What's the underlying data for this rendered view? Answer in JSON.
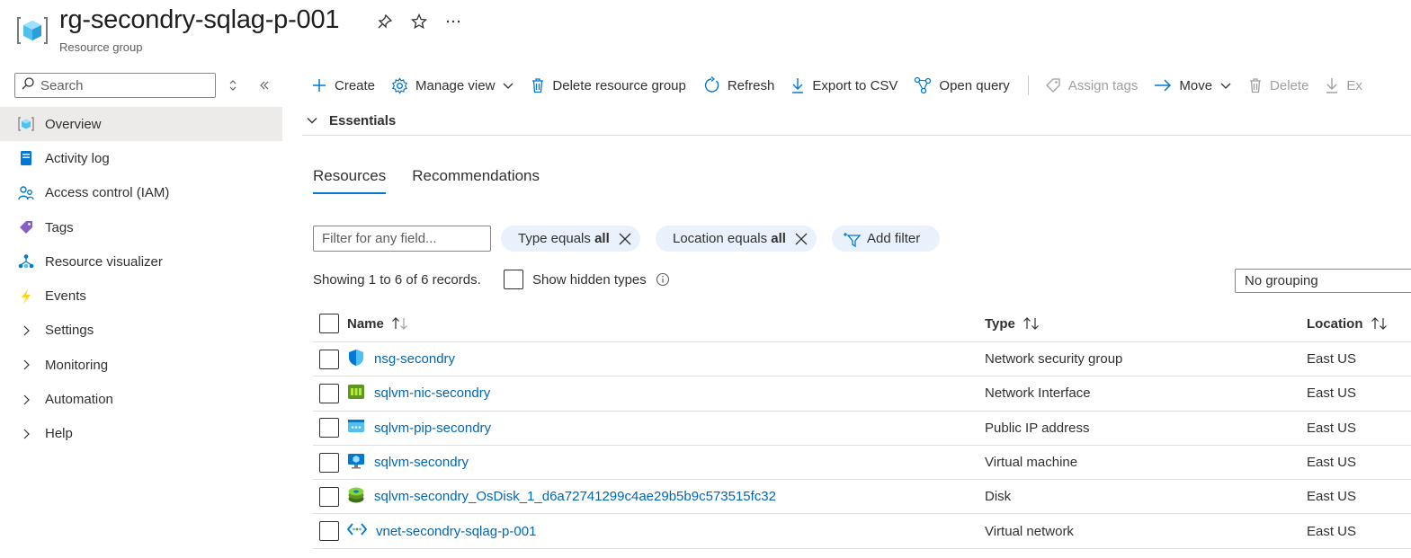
{
  "header": {
    "title": "rg-secondry-sqlag-p-001",
    "subtitle": "Resource group"
  },
  "sidebar": {
    "search_placeholder": "Search",
    "items": [
      {
        "label": "Overview",
        "icon": "resource-group-icon",
        "active": true
      },
      {
        "label": "Activity log",
        "icon": "activity-log-icon"
      },
      {
        "label": "Access control (IAM)",
        "icon": "people-icon"
      },
      {
        "label": "Tags",
        "icon": "tag-icon"
      },
      {
        "label": "Resource visualizer",
        "icon": "hierarchy-icon"
      },
      {
        "label": "Events",
        "icon": "lightning-icon"
      },
      {
        "label": "Settings",
        "icon": "chevron-right-icon"
      },
      {
        "label": "Monitoring",
        "icon": "chevron-right-icon"
      },
      {
        "label": "Automation",
        "icon": "chevron-right-icon"
      },
      {
        "label": "Help",
        "icon": "chevron-right-icon"
      }
    ]
  },
  "toolbar": {
    "create": "Create",
    "manage_view": "Manage view",
    "delete_rg": "Delete resource group",
    "refresh": "Refresh",
    "export_csv": "Export to CSV",
    "open_query": "Open query",
    "assign_tags": "Assign tags",
    "move": "Move",
    "delete": "Delete",
    "export_truncated": "Ex"
  },
  "essentials": {
    "label": "Essentials"
  },
  "tabs": [
    {
      "label": "Resources",
      "active": true
    },
    {
      "label": "Recommendations"
    }
  ],
  "filters": {
    "placeholder": "Filter for any field...",
    "type_prefix": "Type equals ",
    "type_value": "all",
    "location_prefix": "Location equals ",
    "location_value": "all",
    "add_filter": "Add filter"
  },
  "records_text": "Showing 1 to 6 of 6 records.",
  "show_hidden_types": "Show hidden types",
  "grouping": "No grouping",
  "table": {
    "headers": {
      "name": "Name",
      "type": "Type",
      "location": "Location"
    },
    "rows": [
      {
        "name": "nsg-secondry",
        "type": "Network security group",
        "location": "East US",
        "icon": "shield-icon"
      },
      {
        "name": "sqlvm-nic-secondry",
        "type": "Network Interface",
        "location": "East US",
        "icon": "network-interface-icon"
      },
      {
        "name": "sqlvm-pip-secondry",
        "type": "Public IP address",
        "location": "East US",
        "icon": "public-ip-icon"
      },
      {
        "name": "sqlvm-secondry",
        "type": "Virtual machine",
        "location": "East US",
        "icon": "virtual-machine-icon"
      },
      {
        "name": "sqlvm-secondry_OsDisk_1_d6a72741299c4ae29b5b9c573515fc32",
        "type": "Disk",
        "location": "East US",
        "icon": "disk-icon"
      },
      {
        "name": "vnet-secondry-sqlag-p-001",
        "type": "Virtual network",
        "location": "East US",
        "icon": "virtual-network-icon"
      }
    ]
  },
  "colors": {
    "accent": "#0078d4",
    "link": "#0066b8",
    "pill_bg": "#e9f2fc",
    "active_nav_bg": "#edebe9"
  }
}
